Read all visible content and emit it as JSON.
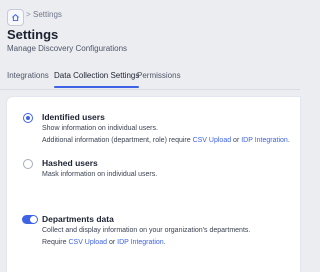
{
  "breadcrumb": {
    "home_icon": "home-icon",
    "separator": ">",
    "current": "Settings"
  },
  "page": {
    "title": "Settings",
    "subtitle": "Manage Discovery Configurations"
  },
  "tabs": [
    {
      "label": "Integrations",
      "active": false
    },
    {
      "label": "Data Collection Settings",
      "active": true
    },
    {
      "label": "Permissions",
      "active": false
    }
  ],
  "options": {
    "identified": {
      "selected": true,
      "title": "Identified users",
      "desc": "Show information on individual users.",
      "note_prefix": "Additional information (department, role) require ",
      "link1": "CSV Upload",
      "or": " or ",
      "link2": "IDP Integration",
      "end": "."
    },
    "hashed": {
      "selected": false,
      "title": "Hashed users",
      "desc": "Mask information on individual users."
    }
  },
  "departments": {
    "enabled": true,
    "title": "Departments data",
    "desc": "Collect and display information on your organization's departments.",
    "note_prefix": "Require ",
    "link1": "CSV Upload",
    "or": " or ",
    "link2": "IDP Integration",
    "end": "."
  },
  "colors": {
    "accent": "#3f63e6",
    "background": "#ecedf1",
    "card": "#ffffff"
  }
}
